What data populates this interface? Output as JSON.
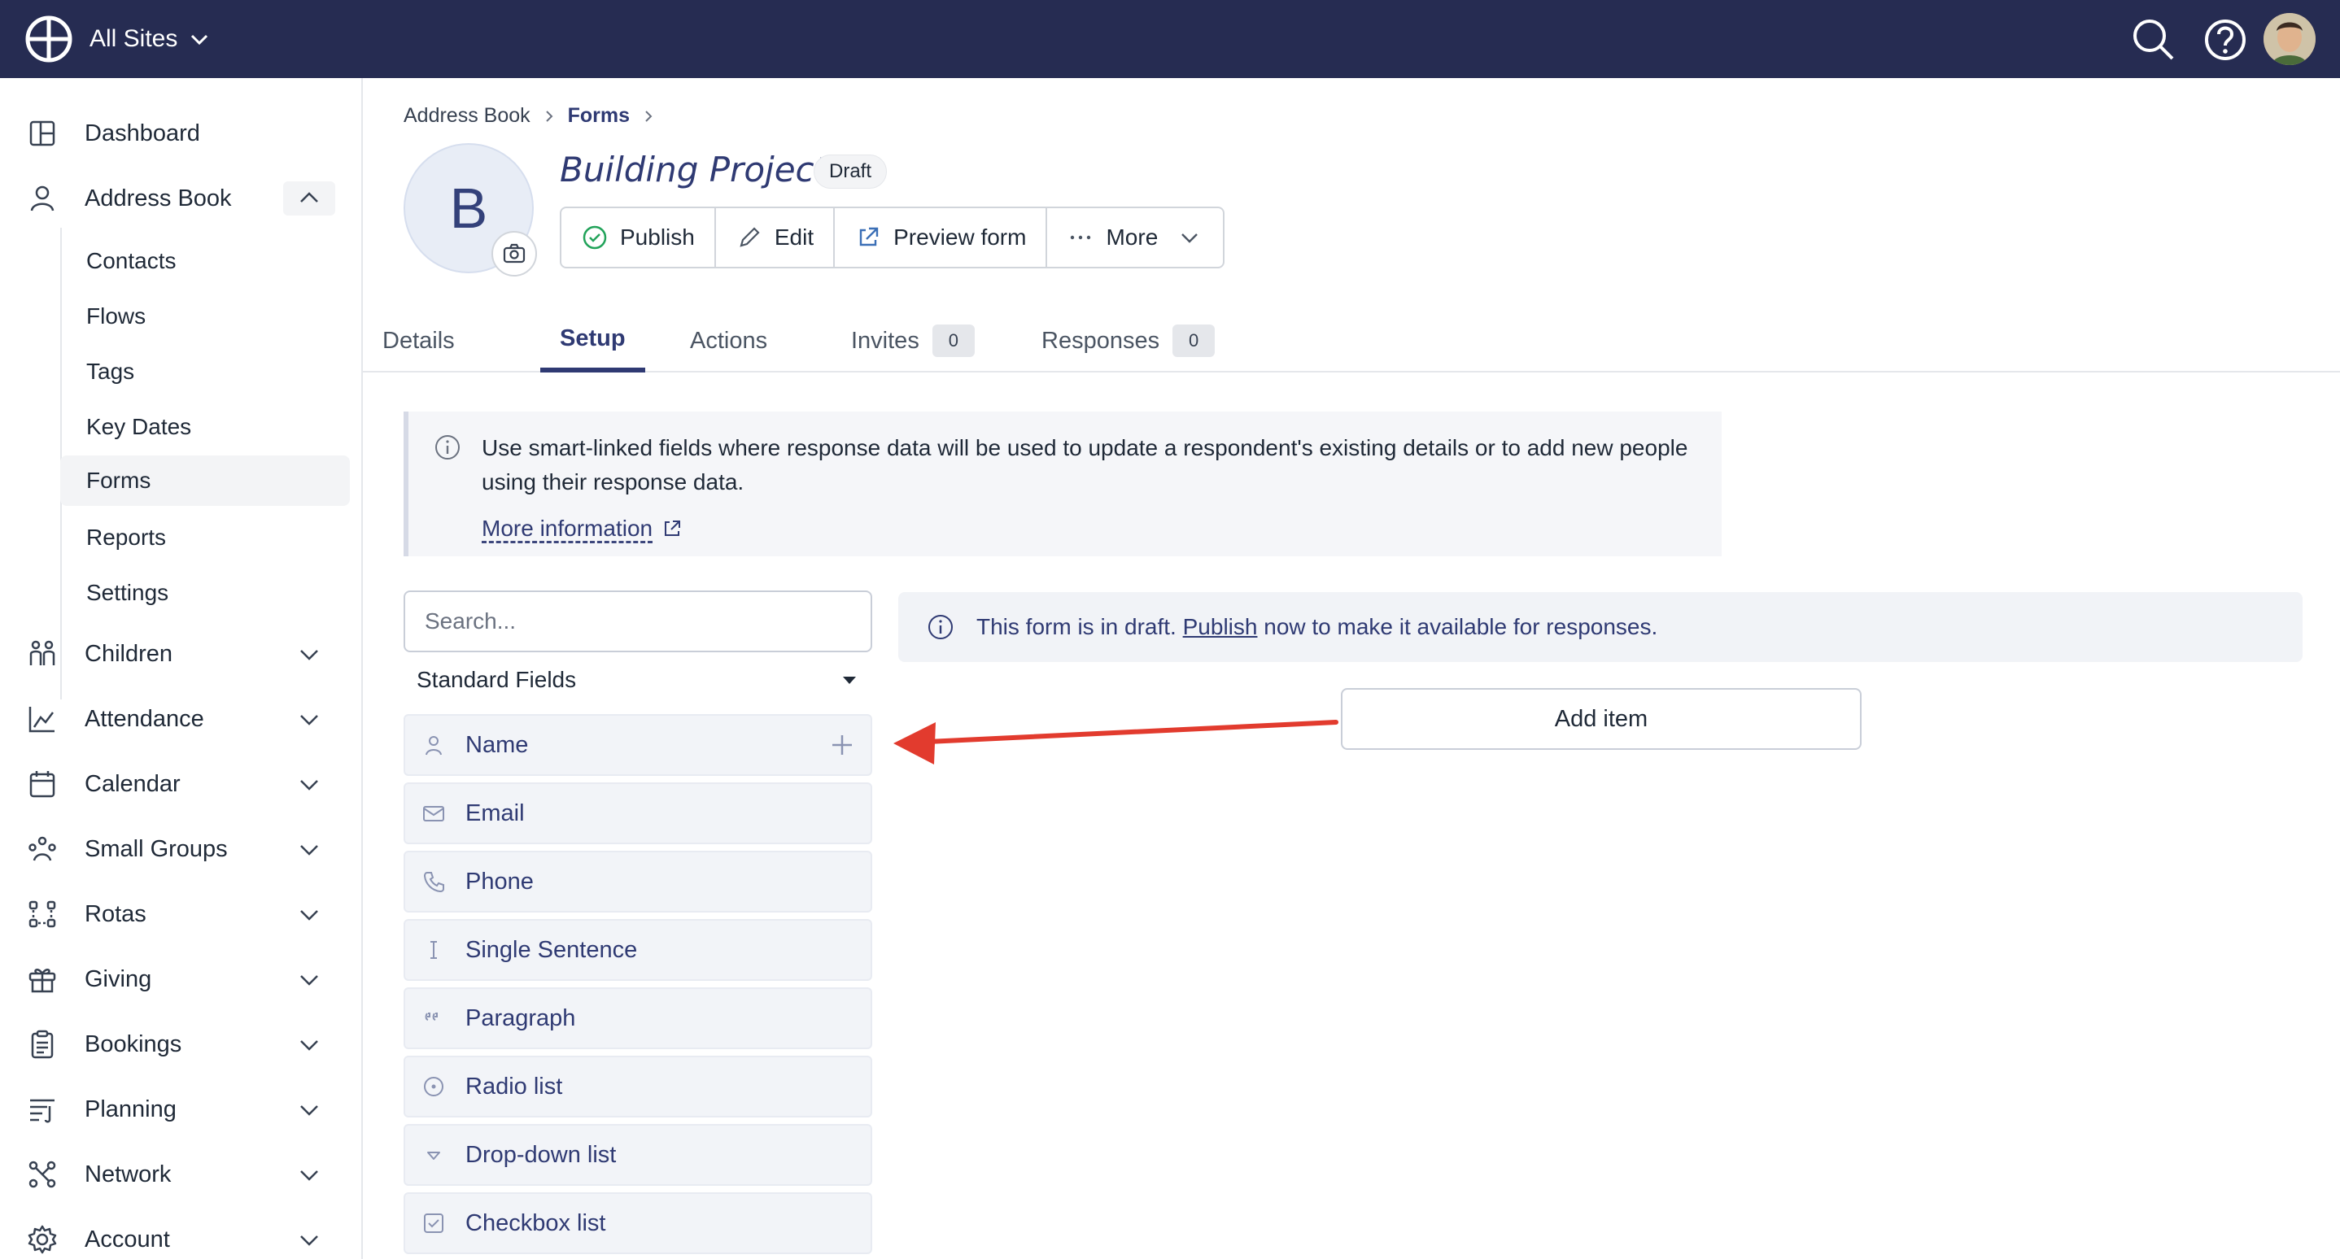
{
  "topbar": {
    "site_switch_label": "All Sites",
    "icons": [
      "app-logo-icon",
      "chevron-down-icon",
      "search-icon",
      "help-icon",
      "user-avatar"
    ]
  },
  "sidebar": {
    "items": [
      {
        "label": "Dashboard",
        "icon": "dashboard-icon"
      },
      {
        "label": "Address Book",
        "icon": "person-icon",
        "expanded": true
      },
      {
        "label": "Children",
        "icon": "children-icon"
      },
      {
        "label": "Attendance",
        "icon": "chart-icon"
      },
      {
        "label": "Calendar",
        "icon": "calendar-icon"
      },
      {
        "label": "Small Groups",
        "icon": "group-icon"
      },
      {
        "label": "Rotas",
        "icon": "rota-icon"
      },
      {
        "label": "Giving",
        "icon": "gift-icon"
      },
      {
        "label": "Bookings",
        "icon": "clipboard-icon"
      },
      {
        "label": "Planning",
        "icon": "planning-icon"
      },
      {
        "label": "Network",
        "icon": "network-icon"
      },
      {
        "label": "Account",
        "icon": "gear-icon"
      }
    ],
    "address_book_sub": [
      "Contacts",
      "Flows",
      "Tags",
      "Key Dates",
      "Forms",
      "Reports",
      "Settings"
    ],
    "active_sub": "Forms"
  },
  "breadcrumb": [
    "Address Book",
    "Forms"
  ],
  "form": {
    "avatar_letter": "B",
    "title": "Building Project",
    "status": "Draft"
  },
  "actions": {
    "publish": "Publish",
    "edit": "Edit",
    "preview": "Preview form",
    "more": "More"
  },
  "tabs": [
    {
      "label": "Details"
    },
    {
      "label": "Setup",
      "active": true
    },
    {
      "label": "Actions"
    },
    {
      "label": "Invites",
      "count": "0"
    },
    {
      "label": "Responses",
      "count": "0"
    }
  ],
  "callout": {
    "text": "Use smart-linked fields where response data will be used to update a respondent's existing details or to add new people using their response data.",
    "link": "More information"
  },
  "fields": {
    "search_placeholder": "Search...",
    "category": "Standard Fields",
    "items": [
      {
        "label": "Name",
        "icon": "person-icon"
      },
      {
        "label": "Email",
        "icon": "envelope-icon"
      },
      {
        "label": "Phone",
        "icon": "phone-icon"
      },
      {
        "label": "Single Sentence",
        "icon": "text-cursor-icon"
      },
      {
        "label": "Paragraph",
        "icon": "quote-icon"
      },
      {
        "label": "Radio list",
        "icon": "radio-icon"
      },
      {
        "label": "Drop-down list",
        "icon": "dropdown-icon"
      },
      {
        "label": "Checkbox list",
        "icon": "checkbox-icon"
      }
    ]
  },
  "draft_notice": {
    "prefix": "This form is in draft. ",
    "link": "Publish",
    "suffix": " now to make it available for responses."
  },
  "add_item_label": "Add item",
  "colors": {
    "topbar": "#262c52",
    "accent": "#2f3a73",
    "annotation_arrow": "#e23b2e",
    "publish_check": "#22a35a"
  }
}
